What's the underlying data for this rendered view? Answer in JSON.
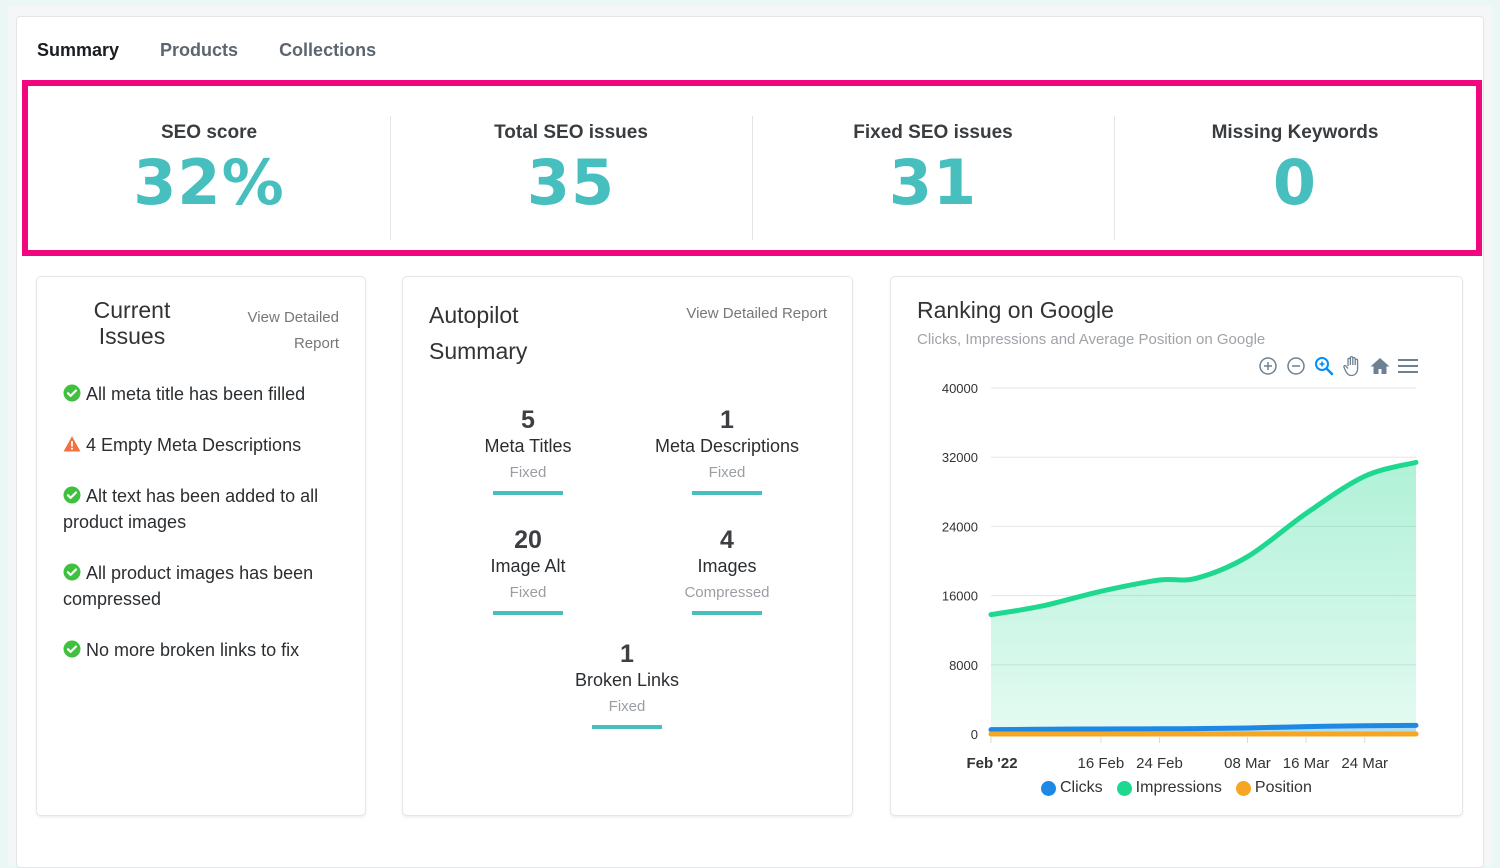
{
  "tabs": [
    {
      "label": "Summary",
      "active": true
    },
    {
      "label": "Products",
      "active": false
    },
    {
      "label": "Collections",
      "active": false
    }
  ],
  "highlight_color": "#f0077f",
  "accent_color": "#47bfbf",
  "stats": [
    {
      "label": "SEO score",
      "value": "32%"
    },
    {
      "label": "Total SEO issues",
      "value": "35"
    },
    {
      "label": "Fixed SEO issues",
      "value": "31"
    },
    {
      "label": "Missing Keywords",
      "value": "0"
    }
  ],
  "current_issues": {
    "title": "Current Issues",
    "link": "View Detailed Report",
    "items": [
      {
        "icon": "check-circle-icon",
        "status": "ok",
        "text": "All meta title has been filled"
      },
      {
        "icon": "warning-triangle-icon",
        "status": "warning",
        "text": "4 Empty Meta Descriptions"
      },
      {
        "icon": "check-circle-icon",
        "status": "ok",
        "text": "Alt text has been added to all product images"
      },
      {
        "icon": "check-circle-icon",
        "status": "ok",
        "text": "All product images has been compressed"
      },
      {
        "icon": "check-circle-icon",
        "status": "ok",
        "text": "No more broken links to fix"
      }
    ]
  },
  "autopilot": {
    "title": "Autopilot Summary",
    "link": "View Detailed Report",
    "items": [
      {
        "count": "5",
        "name": "Meta Titles",
        "status": "Fixed"
      },
      {
        "count": "1",
        "name": "Meta Descriptions",
        "status": "Fixed"
      },
      {
        "count": "20",
        "name": "Image Alt",
        "status": "Fixed"
      },
      {
        "count": "4",
        "name": "Images",
        "status": "Compressed"
      },
      {
        "count": "1",
        "name": "Broken Links",
        "status": "Fixed"
      }
    ]
  },
  "ranking": {
    "title": "Ranking on Google",
    "subtitle": "Clicks, Impressions and Average Position on Google",
    "toolbar": [
      "zoom-in-icon",
      "zoom-out-icon",
      "selection-zoom-icon",
      "pan-hand-icon",
      "reset-home-icon",
      "menu-icon"
    ]
  },
  "chart_data": {
    "type": "area",
    "title": "Ranking on Google",
    "subtitle": "Clicks, Impressions and Average Position on Google",
    "xlabel": "",
    "ylabel": "",
    "ylim": [
      0,
      40000
    ],
    "yticks": [
      0,
      8000,
      16000,
      24000,
      32000,
      40000
    ],
    "grid": true,
    "legend_position": "bottom",
    "x": [
      "2022-02-01",
      "2022-02-08",
      "2022-02-16",
      "2022-02-24",
      "2022-03-01",
      "2022-03-08",
      "2022-03-16",
      "2022-03-24",
      "2022-03-31"
    ],
    "xtick_labels": [
      {
        "date": "2022-02-01",
        "label": "Feb '22",
        "bold": true
      },
      {
        "date": "2022-02-16",
        "label": "16 Feb",
        "bold": false
      },
      {
        "date": "2022-02-24",
        "label": "24 Feb",
        "bold": false
      },
      {
        "date": "2022-03-08",
        "label": "08 Mar",
        "bold": false
      },
      {
        "date": "2022-03-16",
        "label": "16 Mar",
        "bold": false
      },
      {
        "date": "2022-03-24",
        "label": "24 Mar",
        "bold": false
      }
    ],
    "series": [
      {
        "name": "Clicks",
        "color": "#1e88e5",
        "values": [
          500,
          550,
          580,
          600,
          620,
          700,
          850,
          950,
          1000
        ]
      },
      {
        "name": "Impressions",
        "color": "#1fd890",
        "values": [
          13800,
          14800,
          16500,
          17800,
          18000,
          20500,
          25500,
          29800,
          31400
        ]
      },
      {
        "name": "Position",
        "color": "#f5a623",
        "values": [
          0,
          0,
          0,
          0,
          0,
          0,
          0,
          0,
          0
        ]
      }
    ]
  }
}
